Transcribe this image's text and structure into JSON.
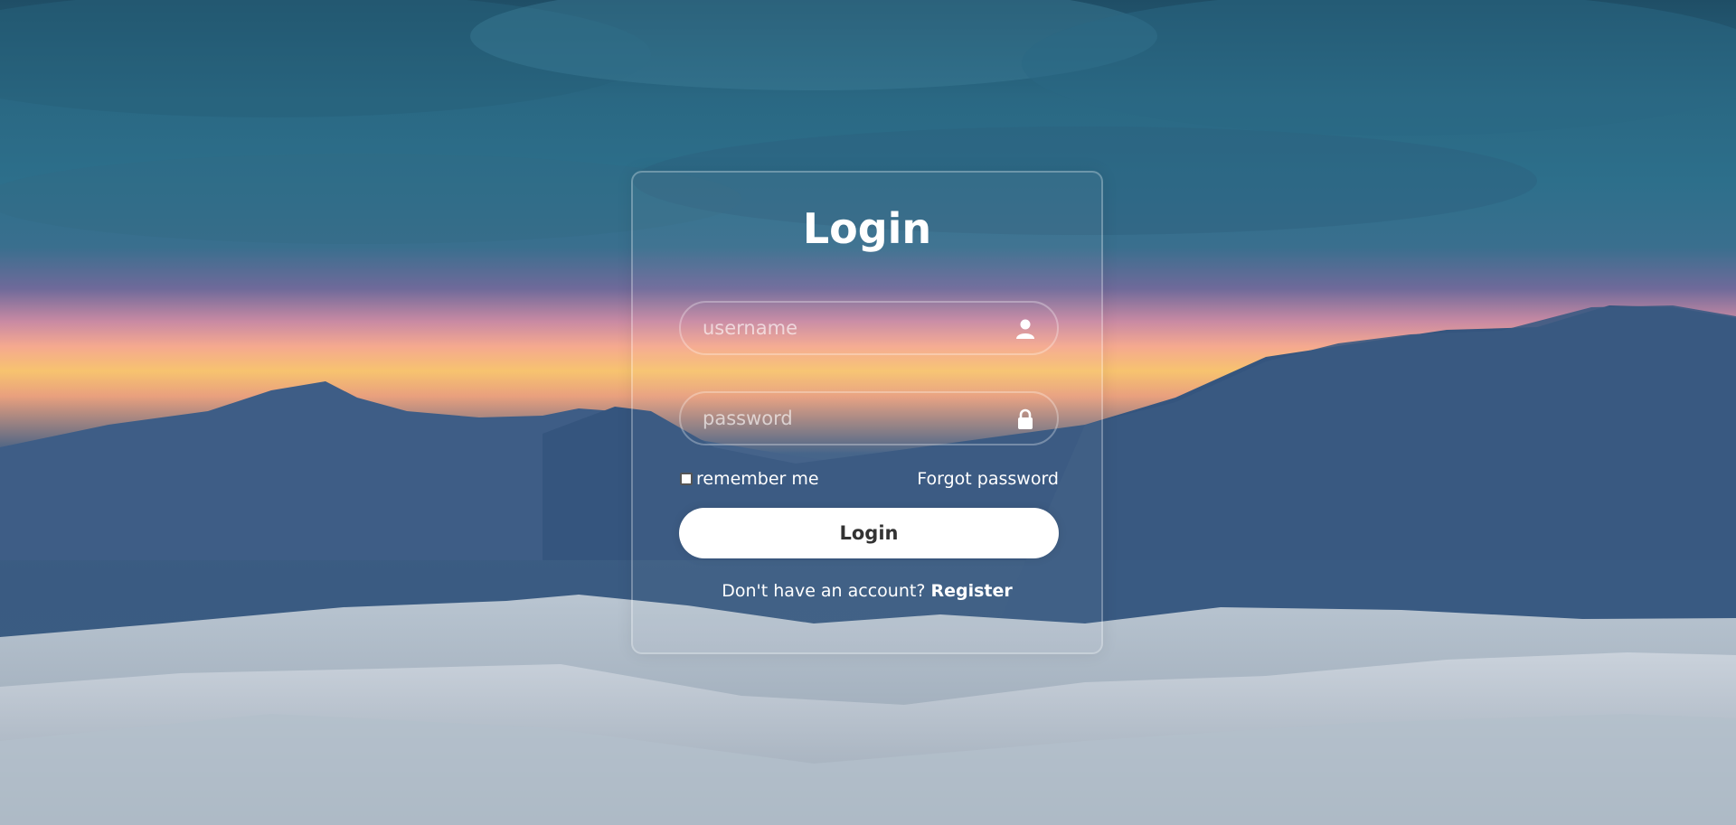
{
  "background": {
    "name": "desert-mountain-sunset-background"
  },
  "login": {
    "title": "Login",
    "username_placeholder": "username",
    "username_icon": "user-icon",
    "password_placeholder": "password",
    "password_icon": "lock-icon",
    "remember_label": "remember me",
    "remember_checked": false,
    "forgot_label": "Forgot password",
    "submit_label": "Login",
    "register_prompt": "Don't have an account?",
    "register_link": "Register"
  },
  "colors": {
    "card_border": "#ffffff",
    "button_bg": "#ffffff",
    "button_text": "#333333",
    "text": "#ffffff"
  }
}
